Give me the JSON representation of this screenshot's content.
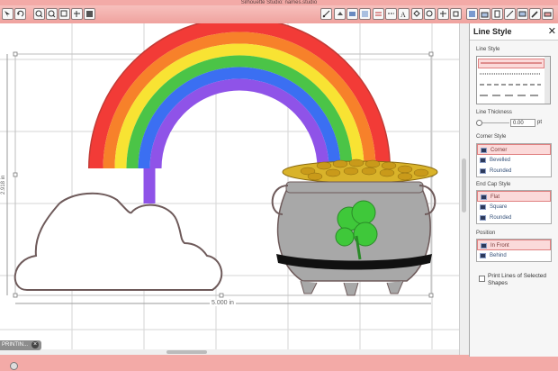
{
  "window": {
    "title": "Silhouette Studio: names.studio"
  },
  "canvas": {
    "width_label": "5.000 in",
    "height_label": "2.918 in"
  },
  "document_tab": {
    "label": "PRINTIN...",
    "close": "×"
  },
  "panel": {
    "title": "Line Style",
    "close": "✕",
    "line_style_label": "Line Style",
    "thickness_label": "Line Thickness",
    "thickness_value": "0.00",
    "thickness_unit": "pt",
    "corner_label": "Corner Style",
    "corner_options": [
      "Corner",
      "Bevelled",
      "Rounded"
    ],
    "endcap_label": "End Cap Style",
    "endcap_options": [
      "Flat",
      "Square",
      "Rounded"
    ],
    "position_label": "Position",
    "position_options": [
      "In Front",
      "Behind"
    ],
    "print_lines_label": "Print Lines of Selected Shapes"
  },
  "colors": {
    "accent": "#f3aaa7",
    "rainbow": [
      "#f23b37",
      "#f7812a",
      "#f8e333",
      "#4bc447",
      "#3b6ff2",
      "#8f53e8"
    ],
    "pot": "#a8a8a8",
    "gold": "#d9b32a",
    "shamrock": "#3fc83a"
  }
}
